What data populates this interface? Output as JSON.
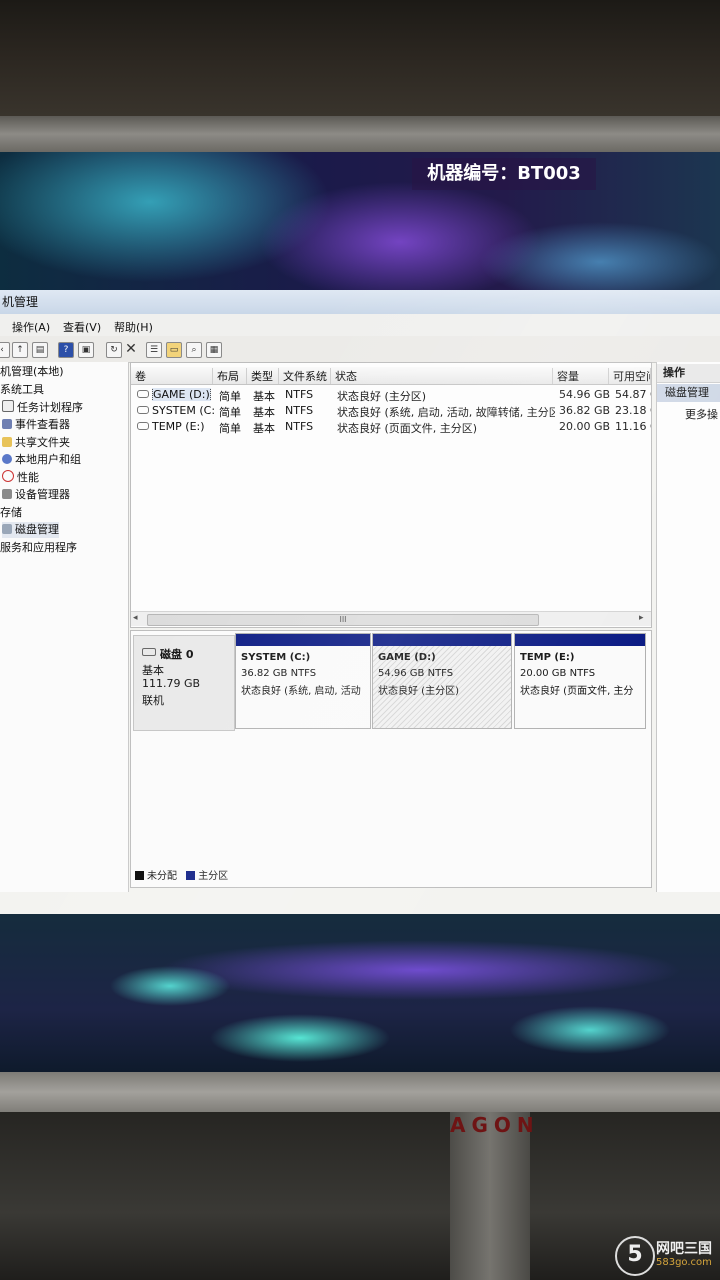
{
  "overlay": {
    "machine_id": "机器编号：BT003"
  },
  "window": {
    "title": "机管理"
  },
  "menu": [
    "操作(A)",
    "查看(V)",
    "帮助(H)"
  ],
  "tree": [
    "机管理(本地)",
    "系统工具",
    "任务计划程序",
    "事件查看器",
    "共享文件夹",
    "本地用户和组",
    "性能",
    "设备管理器",
    "存储",
    "磁盘管理",
    "服务和应用程序"
  ],
  "volume_list": {
    "columns": [
      "卷",
      "布局",
      "类型",
      "文件系统",
      "状态",
      "容量",
      "可用空间"
    ],
    "rows": [
      [
        "GAME (D:)",
        "简单",
        "基本",
        "NTFS",
        "状态良好 (主分区)",
        "54.96 GB",
        "54.87 G"
      ],
      [
        "SYSTEM (C:)",
        "简单",
        "基本",
        "NTFS",
        "状态良好 (系统, 启动, 活动, 故障转储, 主分区)",
        "36.82 GB",
        "23.18 G"
      ],
      [
        "TEMP (E:)",
        "简单",
        "基本",
        "NTFS",
        "状态良好 (页面文件, 主分区)",
        "20.00 GB",
        "11.16 G"
      ]
    ],
    "scroll_grip": "III"
  },
  "disk": {
    "name": "磁盘 0",
    "type": "基本",
    "size": "111.79 GB",
    "status": "联机",
    "partitions": [
      {
        "name": "SYSTEM  (C:)",
        "size": "36.82 GB NTFS",
        "status": "状态良好 (系统, 启动, 活动"
      },
      {
        "name": "GAME  (D:)",
        "size": "54.96 GB NTFS",
        "status": "状态良好 (主分区)"
      },
      {
        "name": "TEMP  (E:)",
        "size": "20.00 GB NTFS",
        "status": "状态良好 (页面文件, 主分"
      }
    ]
  },
  "legend": {
    "unallocated": "未分配",
    "primary": "主分区"
  },
  "actions": {
    "header": "操作",
    "selected": "磁盘管理",
    "more": "更多操"
  },
  "branding": {
    "monitor": "AGON",
    "site_name": "网吧三国",
    "site_domain": "583go.com",
    "site_logo": "5"
  },
  "colors": {
    "partition_bar": "#0a1a83",
    "selection": "#cfd8e6",
    "unallocated": "#000000"
  }
}
